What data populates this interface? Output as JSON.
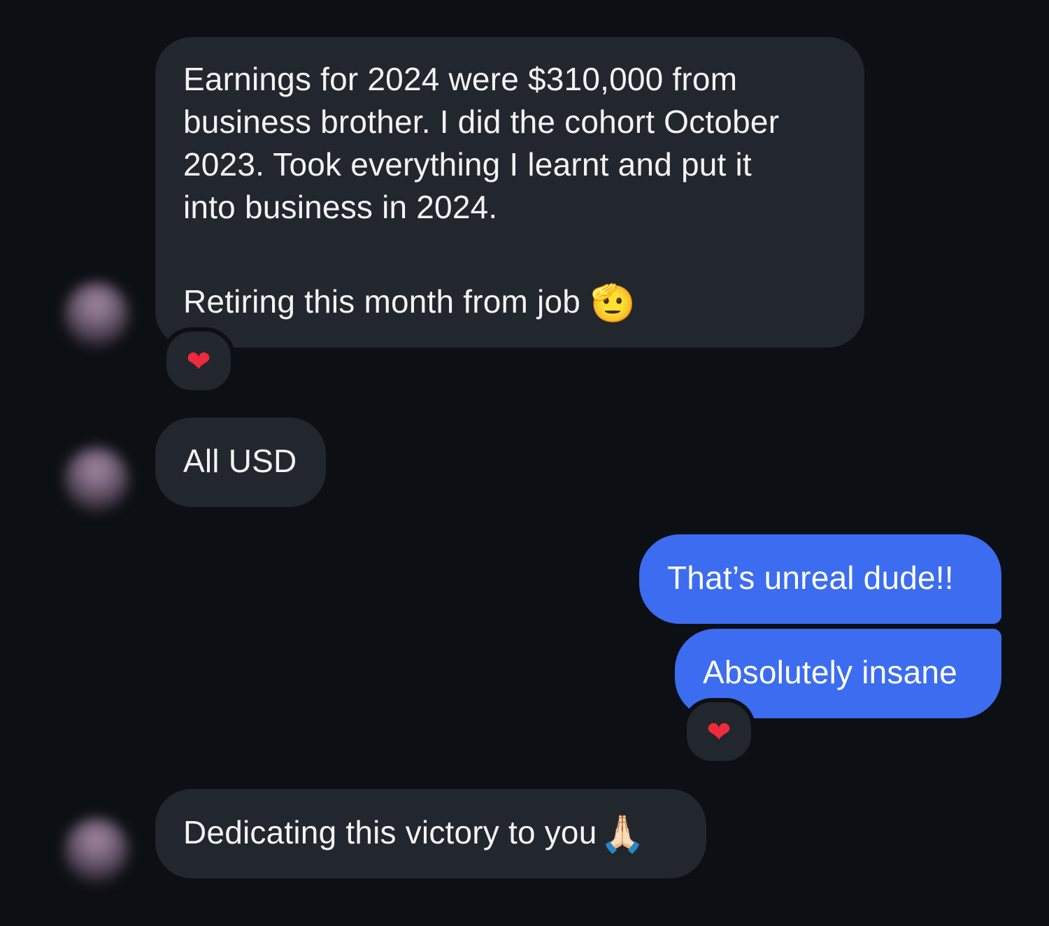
{
  "messages": [
    {
      "id": "m1",
      "direction": "incoming",
      "text_lines": [
        "Earnings for 2024 were $310,000 from",
        "business brother. I did the cohort October",
        "2023. Took everything I learnt and put it",
        "into business in 2024."
      ],
      "text_line2": "Retiring this month from job",
      "emoji": "🫡",
      "emoji_name": "saluting-face",
      "reaction": "❤"
    },
    {
      "id": "m2",
      "direction": "incoming",
      "text": "All USD"
    },
    {
      "id": "m3",
      "direction": "outgoing",
      "text": "That’s unreal dude!!"
    },
    {
      "id": "m4",
      "direction": "outgoing",
      "text": "Absolutely insane",
      "reaction": "❤"
    },
    {
      "id": "m5",
      "direction": "incoming",
      "text": "Dedicating this victory to you",
      "emoji": "🙏🏻",
      "emoji_name": "folded-hands"
    }
  ],
  "colors": {
    "background": "#0c0f13",
    "incoming_bubble": "#22262d",
    "outgoing_bubble": "#3c6cf0",
    "text": "#f2f3f5",
    "heart": "#ef2a3c"
  },
  "icons": {
    "reaction": "heart-icon",
    "avatar": "blurred-avatar"
  }
}
